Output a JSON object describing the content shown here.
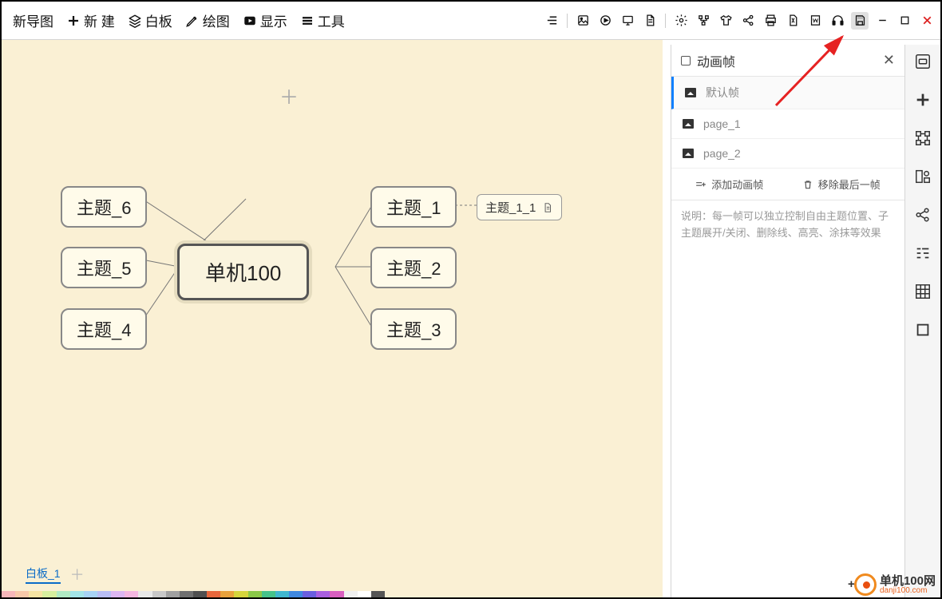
{
  "toolbar": {
    "brand": "新导图",
    "new": "新 建",
    "whiteboard": "白板",
    "draw": "绘图",
    "show": "显示",
    "tools": "工具"
  },
  "canvas": {
    "center": "单机100",
    "topics": {
      "t1": "主题_1",
      "t2": "主题_2",
      "t3": "主题_3",
      "t4": "主题_4",
      "t5": "主题_5",
      "t6": "主题_6",
      "t1_1": "主题_1_1"
    },
    "tab": "白板_1"
  },
  "panel": {
    "title": "动画帧",
    "frames": [
      "默认帧",
      "page_1",
      "page_2"
    ],
    "add": "添加动画帧",
    "remove": "移除最后一帧",
    "note": "说明：每一帧可以独立控制自由主题位置、子主题展开/关闭、删除线、高亮、涂抹等效果"
  },
  "watermark": {
    "name": "单机100网",
    "domain": "danji100.com"
  },
  "colorstrip": [
    "#f6b6b9",
    "#f7c8a8",
    "#f6e4a2",
    "#d7ef9e",
    "#b0eac3",
    "#a3e5e8",
    "#a7d3f5",
    "#b8bdf4",
    "#dcb6f2",
    "#f4b6e0",
    "#e8e8e8",
    "#c8c8c8",
    "#a0a0a0",
    "#707070",
    "#505050",
    "#e8673c",
    "#e8a23c",
    "#d5d53c",
    "#8ac847",
    "#46c38a",
    "#3fb7cf",
    "#3f88e0",
    "#6a5fe0",
    "#a95fe0",
    "#d95fbf",
    "#f0f0f0",
    "#ffffff",
    "#555555"
  ]
}
